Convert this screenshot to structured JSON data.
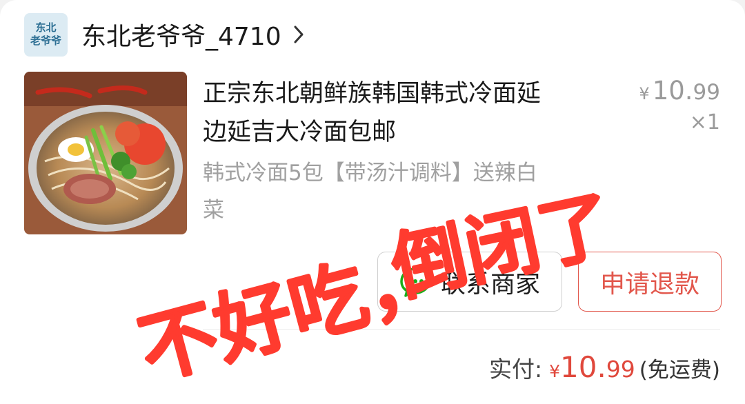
{
  "store": {
    "logo_line1": "东北",
    "logo_line2": "老爷爷",
    "name": "东北老爷爷_4710"
  },
  "product": {
    "title_line1": "正宗东北朝鲜族韩国韩式冷面延",
    "title_line2": "边延吉大冷面包邮",
    "spec_line1": "韩式冷面5包【带汤汁调料】送辣白",
    "spec_line2": "菜",
    "price_symbol": "¥",
    "price_int": "10.",
    "price_dec": "99",
    "quantity": "×1"
  },
  "actions": {
    "contact_label": "联系商家",
    "refund_label": "申请退款"
  },
  "total": {
    "label": "实付:",
    "symbol": "¥",
    "int": "10.",
    "dec": "99",
    "note": "(免运费)"
  },
  "annotation": {
    "line1": "倒闭了",
    "line2": "不好吃，"
  },
  "colors": {
    "accent_red": "#e0483c",
    "wechat_green": "#1aad19"
  }
}
